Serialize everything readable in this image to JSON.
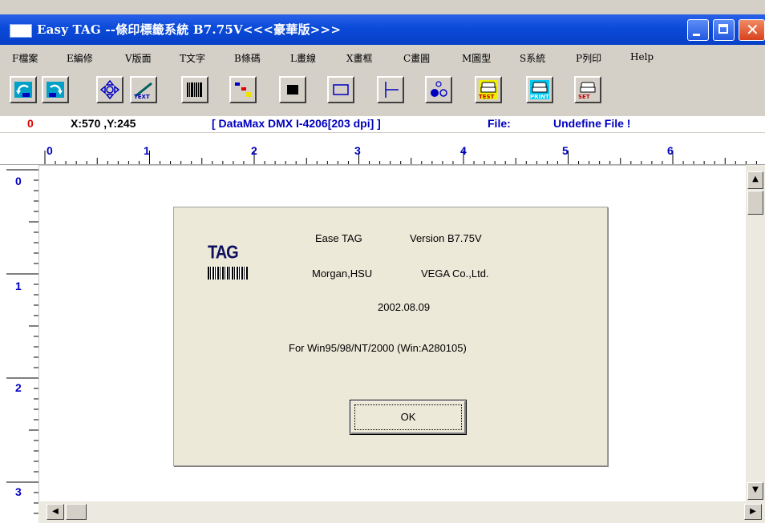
{
  "window": {
    "title": "Easy TAG --條印標籤系統   B7.75V<<<豪華版>>>",
    "close_glyph": "✕"
  },
  "menu": [
    {
      "label": "F檔案"
    },
    {
      "label": "E編修"
    },
    {
      "label": "V版面"
    },
    {
      "label": "T文字"
    },
    {
      "label": "B條碼"
    },
    {
      "label": "L畫線"
    },
    {
      "label": "X畫框"
    },
    {
      "label": "C畫圓"
    },
    {
      "label": "M圖型"
    },
    {
      "label": "S系統"
    },
    {
      "label": "P列印"
    },
    {
      "label": "Help"
    }
  ],
  "toolbar": {
    "icons": [
      "rotate-left-icon",
      "rotate-right-icon",
      "move-icon",
      "text-tool-icon",
      "barcode-tool-icon",
      "shape-tool-icon",
      "filled-rect-icon",
      "rect-icon",
      "line-icon",
      "circle-tool-icon",
      "print-test-icon",
      "print-icon",
      "printer-setup-icon"
    ],
    "text_label": "TEXT",
    "test_label": "TEST",
    "print_label": "PRINT",
    "set_label": "SET"
  },
  "status": {
    "index": "0",
    "coords": "X:570 ,Y:245",
    "printer": "[ DataMax DMX I-4206[203 dpi] ]",
    "file_label": "File:",
    "file_value": "Undefine File !"
  },
  "ruler": {
    "h_labels": [
      "0",
      "1",
      "2",
      "3",
      "4",
      "5",
      "6"
    ],
    "v_labels": [
      "0",
      "1",
      "2",
      "3"
    ]
  },
  "dialog": {
    "logo_text": "TAG",
    "app_name": "Ease TAG",
    "version": "Version  B7.75V",
    "author": "Morgan,HSU",
    "company": "VEGA Co.,Ltd.",
    "date": "2002.08.09",
    "platform": "For Win95/98/NT/2000  (Win:A280105)",
    "ok_label": "OK"
  },
  "scroll": {
    "up": "▲",
    "down": "▼",
    "left": "◀",
    "right": "▶"
  },
  "colors": {
    "titlebar": "#0a4ad8",
    "status_index": "#e00000",
    "status_coords": "#000000",
    "status_info": "#0000c0"
  }
}
